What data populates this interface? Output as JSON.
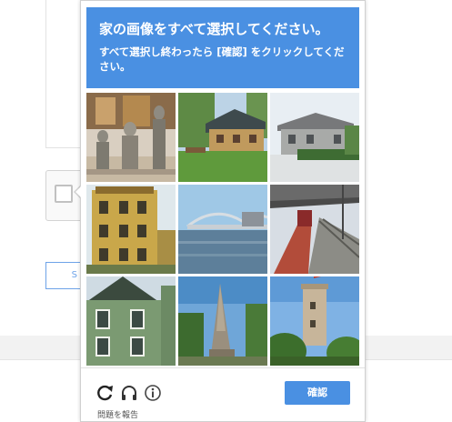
{
  "challenge": {
    "title": "家の画像をすべて選択してください。",
    "instructions": "すべて選択し終わったら [確認] をクリックしてください。",
    "tiles": [
      {
        "subject": "stone-statues-house"
      },
      {
        "subject": "wooden-house"
      },
      {
        "subject": "brick-house"
      },
      {
        "subject": "yellow-apartment-building"
      },
      {
        "subject": "harbor-bridge"
      },
      {
        "subject": "train-station"
      },
      {
        "subject": "green-house"
      },
      {
        "subject": "stone-tower-ruin"
      },
      {
        "subject": "round-tower"
      }
    ],
    "verify_label": "確認",
    "report_label": "問題を報告",
    "accent_color": "#4a90e2"
  },
  "background": {
    "button_label": "S"
  }
}
